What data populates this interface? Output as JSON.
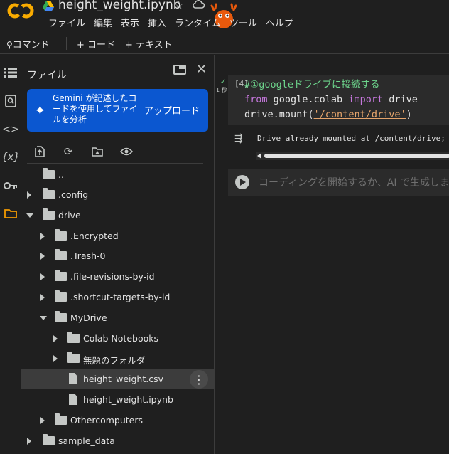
{
  "header": {
    "title": "height_weight.ipynb",
    "menu": [
      "ファイル",
      "編集",
      "表示",
      "挿入",
      "ランタイム",
      "ツール",
      "ヘルプ"
    ]
  },
  "toolbar": {
    "command": "コマンド",
    "add_code": "+ コード",
    "add_text": "+ テキスト"
  },
  "file_panel": {
    "title": "ファイル",
    "gemini": {
      "text": "Gemini が記述したコードを使用してファイルを分析",
      "upload": "アップロード"
    },
    "items": [
      {
        "label": "..",
        "type": "up"
      },
      {
        "label": ".config",
        "type": "folder",
        "state": "collapsed"
      },
      {
        "label": "drive",
        "type": "folder",
        "state": "expanded"
      },
      {
        "label": ".Encrypted",
        "type": "folder",
        "state": "collapsed"
      },
      {
        "label": ".Trash-0",
        "type": "folder",
        "state": "collapsed"
      },
      {
        "label": ".file-revisions-by-id",
        "type": "folder",
        "state": "collapsed"
      },
      {
        "label": ".shortcut-targets-by-id",
        "type": "folder",
        "state": "collapsed"
      },
      {
        "label": "MyDrive",
        "type": "folder",
        "state": "expanded"
      },
      {
        "label": "Colab Notebooks",
        "type": "folder",
        "state": "collapsed"
      },
      {
        "label": "無題のフォルダ",
        "type": "folder",
        "state": "collapsed"
      },
      {
        "label": "height_weight.csv",
        "type": "file",
        "selected": true
      },
      {
        "label": "height_weight.ipynb",
        "type": "file"
      },
      {
        "label": "Othercomputers",
        "type": "folder",
        "state": "collapsed"
      },
      {
        "label": "sample_data",
        "type": "folder",
        "state": "collapsed"
      }
    ]
  },
  "notebook": {
    "cell1": {
      "exec_count": "[4]",
      "exec_time": "1 秒",
      "code": {
        "comment": "#①googleドライブに接続する",
        "kw_from": "from",
        "module": " google.colab ",
        "kw_import": "import",
        "name": " drive",
        "call": "drive.mount(",
        "arg": "'/content/drive'",
        "close": ")"
      },
      "output": "Drive already mounted at /content/drive; to"
    },
    "empty_cell": {
      "placeholder": "コーディングを開始するか、AI で生成します。"
    }
  },
  "colors": {
    "background": "#1f1f1f",
    "cell_bg": "#2b2b2b",
    "accent_blue": "#0b57d0",
    "active_orange": "#f29900",
    "comment_green": "#6dd58c",
    "keyword_purple": "#c678dd"
  }
}
